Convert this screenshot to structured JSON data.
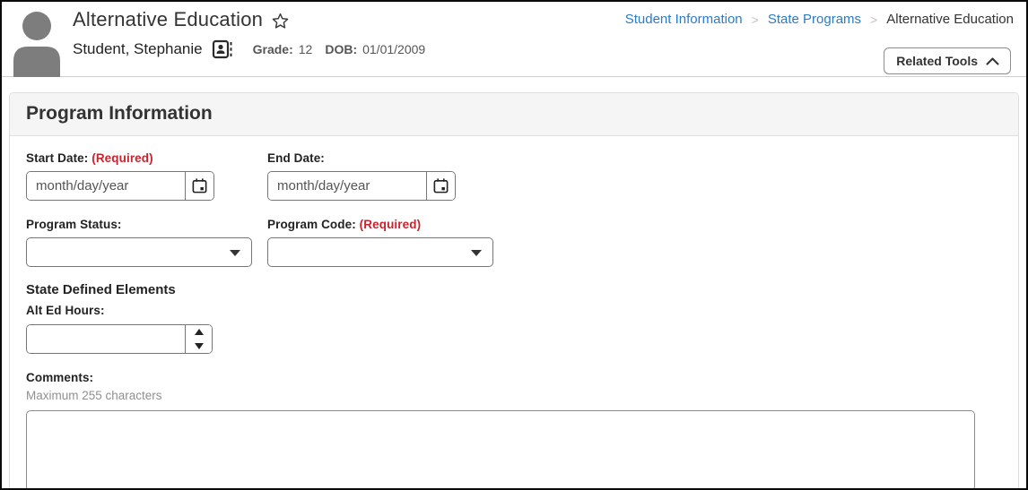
{
  "header": {
    "title": "Alternative Education",
    "student_name": "Student, Stephanie",
    "grade_label": "Grade:",
    "grade_value": "12",
    "dob_label": "DOB:",
    "dob_value": "01/01/2009",
    "related_tools_label": "Related Tools"
  },
  "breadcrumb": {
    "items": [
      {
        "label": "Student Information"
      },
      {
        "label": "State Programs"
      },
      {
        "label": "Alternative Education"
      }
    ],
    "separator": ">"
  },
  "panel": {
    "title": "Program Information",
    "fields": {
      "start_date": {
        "label": "Start Date:",
        "required": "(Required)",
        "placeholder": "month/day/year",
        "value": ""
      },
      "end_date": {
        "label": "End Date:",
        "placeholder": "month/day/year",
        "value": ""
      },
      "program_status": {
        "label": "Program Status:",
        "selected": ""
      },
      "program_code": {
        "label": "Program Code:",
        "required": "(Required)",
        "selected": ""
      },
      "state_defined_heading": "State Defined Elements",
      "alt_ed_hours": {
        "label": "Alt Ed Hours:",
        "value": ""
      },
      "comments": {
        "label": "Comments:",
        "hint": "Maximum 255 characters",
        "value": ""
      }
    }
  },
  "icons": {
    "star": "star-outline",
    "contact_card": "contact-card",
    "calendar": "calendar",
    "chevron_up": "chevron-up",
    "dropdown_arrow": "caret-down",
    "spinner_up": "caret-up",
    "spinner_down": "caret-down",
    "avatar": "person-silhouette"
  },
  "colors": {
    "link_blue": "#2b7bc7",
    "required_red": "#c9232d",
    "avatar_gray": "#7d7d7d",
    "panel_header_bg": "#f5f5f5"
  }
}
